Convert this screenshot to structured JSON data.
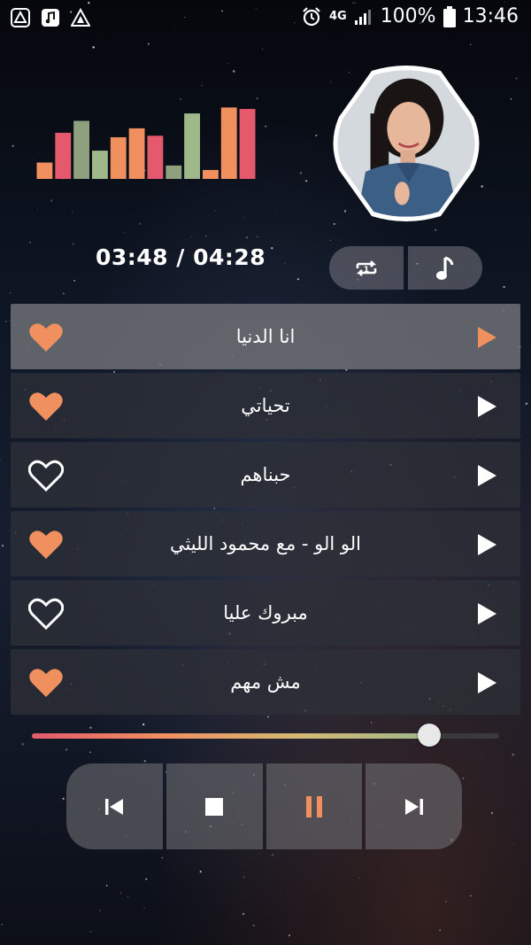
{
  "status_bar": {
    "network": "4G",
    "battery": "100%",
    "time": "13:46",
    "left_icons": [
      "warning-triangle-icon",
      "music-file-icon",
      "warning-triangle-icon"
    ]
  },
  "player": {
    "time_display": "03:48 / 04:28",
    "progress_fraction": 0.85,
    "artist_photo": "artist-avatar",
    "accent_color": "#f0905f"
  },
  "modes": {
    "repeat_icon": "repeat-one-icon",
    "music_icon": "music-note-icon"
  },
  "playlist": [
    {
      "title": "انا الدنيا",
      "favorite": true,
      "active": true
    },
    {
      "title": "تحياتي",
      "favorite": true,
      "active": false
    },
    {
      "title": "حبناهم",
      "favorite": false,
      "active": false
    },
    {
      "title": "الو الو - مع محمود الليثي",
      "favorite": true,
      "active": false
    },
    {
      "title": "مبروك عليا",
      "favorite": false,
      "active": false
    },
    {
      "title": "مش مهم",
      "favorite": true,
      "active": false
    }
  ],
  "controls": [
    "previous-icon",
    "stop-icon",
    "pause-icon",
    "next-icon"
  ],
  "equalizer": {
    "levels": [
      0.22,
      0.62,
      0.78,
      0.38,
      0.56,
      0.68,
      0.58,
      0.18,
      0.88,
      0.12,
      0.96,
      0.94
    ],
    "colors": [
      "#f0905f",
      "#e45a6c",
      "#8fa07e",
      "#9fb88a",
      "#f0905f",
      "#f0905f",
      "#e45a6c",
      "#8fa07e",
      "#9fb88a",
      "#f0905f",
      "#f0905f",
      "#e45a6c"
    ]
  }
}
